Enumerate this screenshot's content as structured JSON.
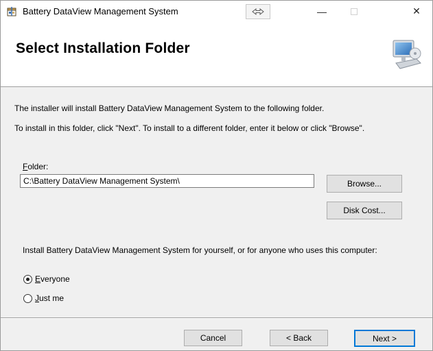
{
  "window": {
    "title": "Battery DataView Management System",
    "minimize_glyph": "—",
    "close_glyph": "✕"
  },
  "header": {
    "title": "Select Installation Folder"
  },
  "body": {
    "intro_line1": "The installer will install Battery DataView Management System to the following folder.",
    "intro_line2": "To install in this folder, click \"Next\". To install to a different folder, enter it below or click \"Browse\".",
    "folder_label_mnemonic": "F",
    "folder_label_rest": "older:",
    "folder_value": "C:\\Battery DataView Management System\\",
    "browse_label": "Browse...",
    "disk_cost_label": "Disk Cost...",
    "install_for_prompt": "Install Battery DataView Management System for yourself, or for anyone who uses this computer:",
    "radio_everyone_mnemonic": "E",
    "radio_everyone_rest": "veryone",
    "radio_justme_mnemonic": "J",
    "radio_justme_rest": "ust me",
    "selected_option": "Everyone"
  },
  "footer": {
    "cancel_label": "Cancel",
    "back_label": "< Back",
    "next_label": "Next >"
  },
  "colors": {
    "accent": "#0078d7",
    "window_bg": "#f0f0f0",
    "banner_bg": "#ffffff"
  },
  "icons": {
    "app": "installer-package-icon",
    "banner": "computer-icon",
    "resize": "resize-arrows-icon"
  }
}
